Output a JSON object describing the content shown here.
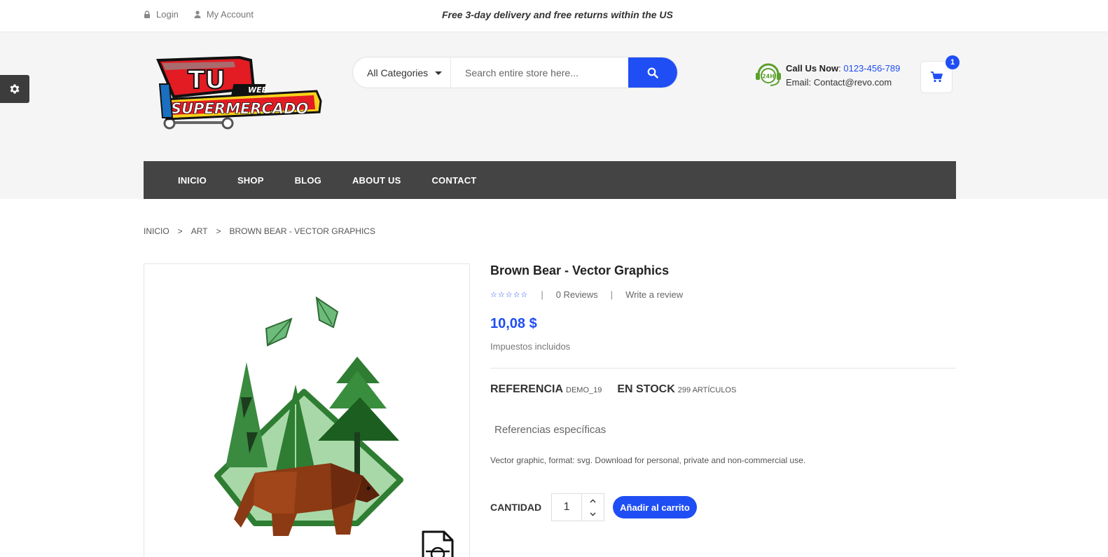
{
  "topbar": {
    "login": "Login",
    "account": "My Account",
    "promo": "Free 3-day delivery and free returns within the US"
  },
  "header": {
    "logo_text_top": "TU",
    "logo_text_web": "WEB",
    "logo_text_main": "SUPERMERCADO",
    "search_category": "All Categories",
    "search_placeholder": "Search entire store here...",
    "call_label": "Call Us Now",
    "call_phone": "0123-456-789",
    "email_line": "Email: Contact@revo.com",
    "call_icon_text": "24H",
    "cart_count": "1"
  },
  "nav": {
    "items": [
      "INICIO",
      "SHOP",
      "BLOG",
      "ABOUT US",
      "CONTACT"
    ]
  },
  "breadcrumb": {
    "items": [
      "INICIO",
      "ART",
      "BROWN BEAR - VECTOR GRAPHICS"
    ],
    "sep": ">"
  },
  "product": {
    "title": "Brown Bear - Vector Graphics",
    "stars": "☆☆☆☆☆",
    "reviews": "0 Reviews",
    "write_review": "Write a review",
    "separator": "|",
    "price": "10,08 $",
    "tax": "Impuestos incluidos",
    "ref_label": "REFERENCIA",
    "ref_value": "demo_19",
    "stock_label": "EN STOCK",
    "stock_value": "299 Artículos",
    "specific_label": "Referencias específicas",
    "description": "Vector graphic, format: svg. Download for personal, private and non-commercial use.",
    "qty_label": "CANTIDAD",
    "qty_value": "1",
    "add_to_cart": "Añadir al carrito"
  },
  "colors": {
    "accent": "#1f4ef5",
    "nav_bg": "#444444",
    "header_bg": "#f5f5f5"
  }
}
